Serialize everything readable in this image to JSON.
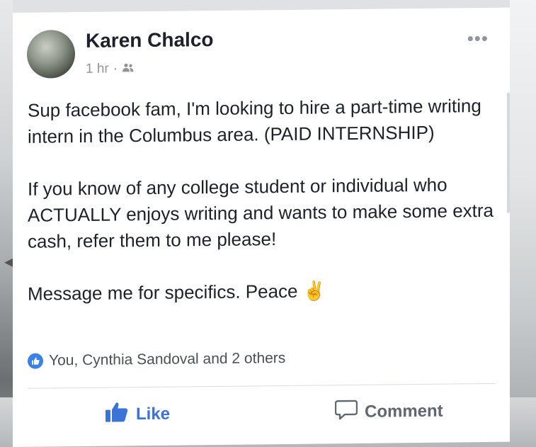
{
  "post": {
    "author": "Karen Chalco",
    "time": "1 hr",
    "separator": "·",
    "paragraphs": [
      "Sup facebook fam, I'm looking to hire a part-time writing intern in the Columbus area. (PAID INTERNSHIP)",
      "If you know of any college student or individual who ACTUALLY enjoys writing and wants to make some extra cash, refer them to me please!",
      "Message me for specifics. Peace ✌"
    ],
    "reactions": "You, Cynthia Sandoval and 2 others"
  },
  "actions": {
    "like_label": "Like",
    "comment_label": "Comment"
  },
  "icons": {
    "audience": "friends-icon",
    "more": "more-options-icon"
  },
  "colors": {
    "like_blue": "#3b73d6",
    "text": "#1d2129",
    "meta": "#90949c"
  }
}
